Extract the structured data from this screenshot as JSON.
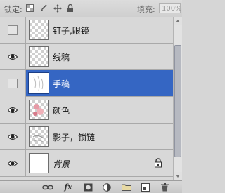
{
  "lockbar": {
    "lock_label": "锁定:",
    "fill_label": "填充:",
    "fill_value": "100%",
    "lock_icons": [
      "lock-transparent-icon",
      "lock-paint-icon",
      "lock-move-icon",
      "lock-all-icon"
    ]
  },
  "layers": [
    {
      "name": "钉子,眼镜",
      "visible": false,
      "selected": false,
      "thumb": "transparent"
    },
    {
      "name": "线稿",
      "visible": true,
      "selected": false,
      "thumb": "transparent"
    },
    {
      "name": "手稿",
      "visible": false,
      "selected": true,
      "thumb": "sketch"
    },
    {
      "name": "颜色",
      "visible": true,
      "selected": false,
      "thumb": "color"
    },
    {
      "name": "影子，锁链",
      "visible": true,
      "selected": false,
      "thumb": "shadow"
    },
    {
      "name": "背景",
      "visible": true,
      "selected": false,
      "thumb": "white",
      "locked": true
    }
  ],
  "toolbar": {
    "fx_label": "fx",
    "icons": [
      "link-icon",
      "fx-icon",
      "mask-icon",
      "adjustment-icon",
      "folder-icon",
      "new-layer-icon",
      "trash-icon"
    ]
  },
  "colors": {
    "selection": "#3566c3",
    "panel": "#d4d4d4"
  }
}
